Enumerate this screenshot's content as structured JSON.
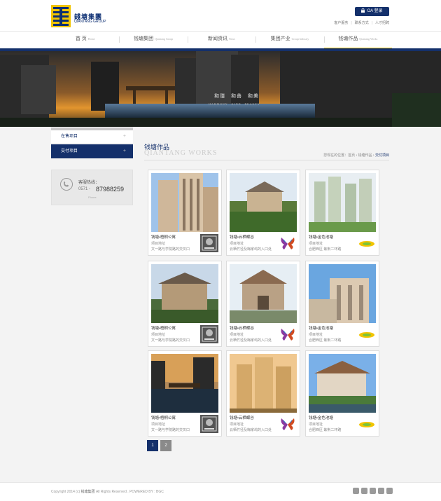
{
  "header": {
    "logo_cn": "錢塘集團",
    "logo_en": "QIANTANG GROUP",
    "oa_label": "OA 登录",
    "links": [
      "客户服务",
      "联系方式",
      "人才招聘"
    ]
  },
  "nav": [
    {
      "cn": "首 页",
      "en": "Home"
    },
    {
      "cn": "钱塘集团",
      "en": "Qiantang Group"
    },
    {
      "cn": "新闻资讯",
      "en": "News"
    },
    {
      "cn": "集团产业",
      "en": "Group Industry"
    },
    {
      "cn": "钱塘作品",
      "en": "Qiantang Works"
    }
  ],
  "banner": {
    "slogan": "和谐　和善　和美",
    "slogan_en": "HARMONY　KIND　BEAUTY"
  },
  "sidebar": {
    "items": [
      "在售项目",
      "交付项目"
    ],
    "hotline_label": "客服热线：",
    "hotline_area": "0571 -",
    "hotline_number": "87988259",
    "hotline_en": "Phone"
  },
  "main": {
    "title": "钱塘作品",
    "subtitle": "QIANTANG WORKS",
    "breadcrumb_prefix": "您现在的位置：首页 › 钱塘作品 › ",
    "breadcrumb_current": "交付项目"
  },
  "cards": [
    {
      "title": "钱塘•梧桐公寓",
      "line1": "项目地址",
      "line2": "文一路与学院路的交叉口",
      "logo": "wutong-logo"
    },
    {
      "title": "钱塘•云栖蝶谷",
      "line1": "项目地址",
      "line2": "云栖竹径及梅家坞的入口处",
      "logo": "butterfly-logo"
    },
    {
      "title": "钱塘•金色池塘",
      "line1": "项目地址",
      "line2": "合肥西区 紫荆二环路",
      "logo": "golden-pond-logo"
    },
    {
      "title": "钱塘•梧桐公寓",
      "line1": "项目地址",
      "line2": "文一路与学院路的交叉口",
      "logo": "wutong-logo"
    },
    {
      "title": "钱塘•云栖蝶谷",
      "line1": "项目地址",
      "line2": "云栖竹径及梅家坞的入口处",
      "logo": "butterfly-logo"
    },
    {
      "title": "钱塘•金色池塘",
      "line1": "项目地址",
      "line2": "合肥西区 紫荆二环路",
      "logo": "golden-pond-logo"
    },
    {
      "title": "钱塘•梧桐公寓",
      "line1": "项目地址",
      "line2": "文一路与学院路的交叉口",
      "logo": "wutong-logo"
    },
    {
      "title": "钱塘•云栖蝶谷",
      "line1": "项目地址",
      "line2": "云栖竹径及梅家坞的入口处",
      "logo": "butterfly-logo"
    },
    {
      "title": "钱塘•金色池塘",
      "line1": "项目地址",
      "line2": "合肥西区 紫荆二环路",
      "logo": "golden-pond-logo"
    }
  ],
  "pagination": [
    "1",
    "2"
  ],
  "footer": {
    "copyright_prefix": "Copyright 2014 (c)",
    "company": "钱塘集团",
    "copyright_suffix": "All Rights Reserved . POWERED BY : BGC"
  },
  "colors": {
    "primary": "#14306b",
    "accent": "#f1c400"
  }
}
